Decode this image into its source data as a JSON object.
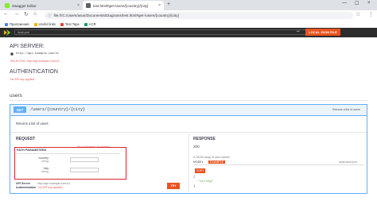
{
  "browser": {
    "tabs": [
      {
        "label": "Swagger Editor",
        "close": "×",
        "favicon_color": "#85ea2d"
      },
      {
        "label": "test.html#get-/users/{country}/{city}",
        "close": "×",
        "favicon_color": "#5f6368"
      }
    ],
    "new_tab": "+",
    "window_controls": [
      "—",
      "☐",
      "×"
    ],
    "address": "file:///C:/Users/asus/Documents/Diagrams/test.html#get-/users/{country}/{city}",
    "bookmarks": [
      {
        "label": "Приложения",
        "color": "#4285f4"
      },
      {
        "label": "Useful links",
        "color": "#f4b400"
      },
      {
        "label": "Test Tape",
        "color": "#db4437"
      },
      {
        "label": "ACR",
        "color": "#0f9d58"
      }
    ]
  },
  "swagger": {
    "url_value": "/test.yml",
    "load_button": "LOCAL JSON FILE",
    "accent": "#e8531f"
  },
  "api_server": {
    "heading": "API SERVER:",
    "url": "http://api.example.com/v1",
    "selected": "SELECTED: http://api.example.com/v1"
  },
  "authentication": {
    "heading": "AUTHENTICATION",
    "none": "No API key applied"
  },
  "section": {
    "title": "users"
  },
  "operation": {
    "method": "GET",
    "path": "/users/{country}/{city}",
    "summary": "Returns a list of users",
    "description": "Returns a list of users.",
    "request": {
      "heading": "REQUEST",
      "no_examples": "No examples available",
      "params_heading": "PATH PARAMETERS",
      "params": [
        {
          "name": "*country",
          "type": "string"
        },
        {
          "name": "*city",
          "type": "string"
        }
      ],
      "api_server_label": "API Server",
      "api_server_value": "http://api.example.com/v1",
      "auth_label": "Authentication",
      "auth_value": "No API key applied",
      "try_button": "TRY"
    },
    "response": {
      "heading": "RESPONSE",
      "code": "200",
      "description": "A JSON array of user names",
      "tabs": [
        "MODEL",
        "EXAMPLE"
      ],
      "content_type": "application/json",
      "copy_button": "COPY",
      "example_lines": [
        "[",
        "\"string\"",
        "]"
      ]
    }
  }
}
